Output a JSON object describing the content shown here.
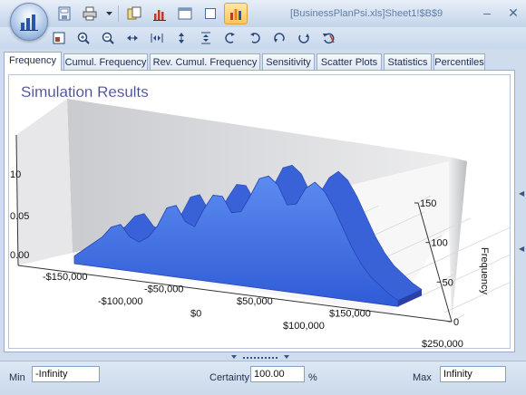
{
  "window": {
    "title": "[BusinessPlanPsi.xls]Sheet1!$B$9"
  },
  "quick_access": [
    "save-icon",
    "print-icon",
    "dropdown-arrow-icon",
    "copy-icon",
    "bar-chart-icon",
    "window-icon",
    "blank-window-icon",
    "chart-selected-icon"
  ],
  "toolbar": [
    "image-icon",
    "zoom-in-icon",
    "zoom-out-icon",
    "fit-width-icon",
    "expand-width-icon",
    "fit-height-icon",
    "expand-height-icon",
    "rotate-left-icon",
    "rotate-right-icon",
    "rotate-up-icon",
    "rotate-down-icon",
    "reset-view-icon"
  ],
  "tabs": [
    {
      "label": "Frequency",
      "active": true
    },
    {
      "label": "Cumul. Frequency",
      "active": false
    },
    {
      "label": "Rev. Cumul. Frequency",
      "active": false
    },
    {
      "label": "Sensitivity",
      "active": false
    },
    {
      "label": "Scatter Plots",
      "active": false
    },
    {
      "label": "Statistics",
      "active": false
    },
    {
      "label": "Percentiles",
      "active": false
    }
  ],
  "chart_data": {
    "type": "area",
    "title": "Simulation Results",
    "ylabel": "Frequency",
    "x_ticks": [
      "-$150,000",
      "-$100,000",
      "-$50,000",
      "$0",
      "$50,000",
      "$100,000",
      "$150,000",
      "$250,000"
    ],
    "x_range": [
      -150000,
      250000
    ],
    "y_ticks": [
      "0",
      "50",
      "100",
      "150"
    ],
    "y_range": [
      0,
      150
    ],
    "left_axis_ticks": [
      "0.00",
      "0.05",
      "10"
    ],
    "x": [
      -150000,
      -140000,
      -130000,
      -120000,
      -110000,
      -100000,
      -90000,
      -80000,
      -70000,
      -60000,
      -50000,
      -40000,
      -30000,
      -20000,
      -10000,
      0,
      10000,
      20000,
      30000,
      40000,
      50000,
      60000,
      70000,
      80000,
      90000,
      100000,
      110000,
      120000,
      130000,
      140000,
      150000,
      160000,
      170000,
      180000,
      190000,
      200000
    ],
    "values": [
      10,
      20,
      30,
      40,
      55,
      60,
      45,
      40,
      48,
      65,
      90,
      95,
      75,
      70,
      95,
      115,
      115,
      95,
      98,
      120,
      145,
      150,
      140,
      115,
      118,
      140,
      150,
      140,
      120,
      95,
      70,
      50,
      35,
      25,
      15,
      8
    ],
    "grid": true,
    "view": "3d"
  },
  "bottom": {
    "min_label": "Min",
    "min_value": "-Infinity",
    "certainty_label": "Certainty",
    "certainty_value": "100.00",
    "certainty_unit": "%",
    "max_label": "Max",
    "max_value": "Infinity"
  }
}
